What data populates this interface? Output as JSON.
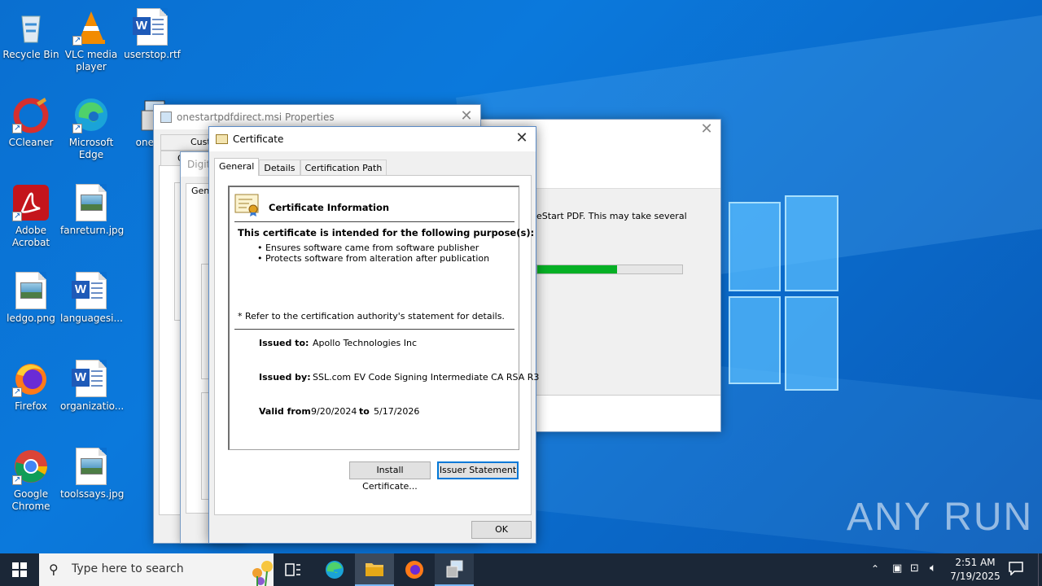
{
  "desktop": {
    "icons": [
      {
        "label": "Recycle Bin",
        "icon": "recycle-bin-icon"
      },
      {
        "label": "VLC media player",
        "icon": "vlc-icon"
      },
      {
        "label": "userstop.rtf",
        "icon": "word-document-icon"
      },
      {
        "label": "CCleaner",
        "icon": "ccleaner-icon"
      },
      {
        "label": "Microsoft Edge",
        "icon": "edge-icon"
      },
      {
        "label": "onesta",
        "icon": "installer-icon"
      },
      {
        "label": "Adobe Acrobat",
        "icon": "acrobat-icon"
      },
      {
        "label": "fanreturn.jpg",
        "icon": "image-file-icon"
      },
      {
        "label": "ledgo.png",
        "icon": "image-file-icon"
      },
      {
        "label": "languagesi...",
        "icon": "word-document-icon"
      },
      {
        "label": "Firefox",
        "icon": "firefox-icon"
      },
      {
        "label": "organizatio...",
        "icon": "word-document-icon"
      },
      {
        "label": "Google Chrome",
        "icon": "chrome-icon"
      },
      {
        "label": "toolssays.jpg",
        "icon": "image-file-icon"
      }
    ],
    "watermark": "ANY RUN"
  },
  "background_windows": {
    "properties_title": "onestartpdfdirect.msi Properties",
    "partial_tab_1": "Cust",
    "partial_tab_2": "G",
    "partial_tab_3": "Digit",
    "partial_tab_4": "Gen",
    "installer_text": "eStart PDF.  This may take several",
    "installer_progress": 0.55
  },
  "certificate_dialog": {
    "title": "Certificate",
    "tabs": [
      "General",
      "Details",
      "Certification Path"
    ],
    "heading": "Certificate Information",
    "purpose_heading": "This certificate is intended for the following purpose(s):",
    "purposes": [
      "• Ensures software came from software publisher",
      "• Protects software from alteration after publication"
    ],
    "note": "* Refer to the certification authority's statement for details.",
    "issued_to_label": "Issued to:",
    "issued_to": "Apollo Technologies Inc",
    "issued_by_label": "Issued by:",
    "issued_by": "SSL.com EV Code Signing Intermediate CA RSA R3",
    "valid_from_label": "Valid from",
    "valid_from": "9/20/2024",
    "to_label": "to",
    "valid_to": "5/17/2026",
    "install_button": "Install Certificate...",
    "issuer_button": "Issuer Statement",
    "ok_button": "OK"
  },
  "taskbar": {
    "search_placeholder": "Type here to search",
    "time": "2:51 AM",
    "date": "7/19/2025"
  },
  "colors": {
    "accent": "#0078d7",
    "progress": "#06b025",
    "taskbar": "#1b2737"
  }
}
